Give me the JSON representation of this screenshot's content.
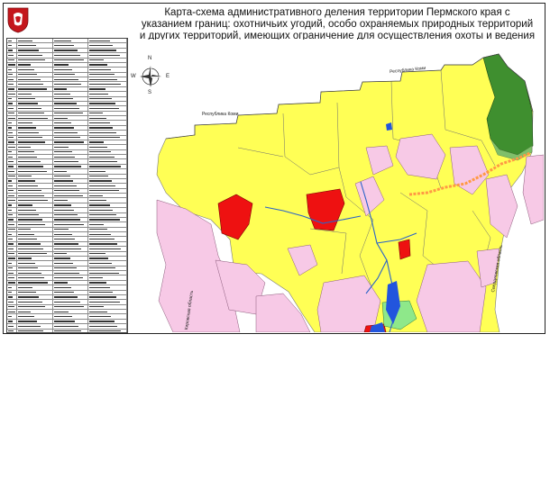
{
  "header": {
    "title": "Карта-схема административного деления территории Пермского края с указанием границ: охотничьих угодий, особо охраняемых природных территорий и других территорий, имеющих ограничение для осуществления охоты и ведения охотничьего хозяйства"
  },
  "icons": {
    "coat_of_arms": "perm-coat-of-arms-icon",
    "compass": "compass-rose-icon"
  },
  "compass": {
    "n": "N",
    "s": "S",
    "e": "E",
    "w": "W"
  },
  "legend": {
    "row_count": 74
  },
  "map": {
    "labels": {
      "north_boundary": "Республика Коми",
      "northwest_boundary": "Республика Коми",
      "east_boundary": "Свердловская область",
      "west_boundary": "Кировская область"
    },
    "colors": {
      "hunting_grounds": "#ffff55",
      "protected_areas": "#ee1111",
      "restricted_areas": "#f7c9e6",
      "reserve": "#3f8f2f",
      "water": "#2255dd",
      "light_green": "#8ee88a",
      "orange_corridor": "#ff9944"
    }
  }
}
